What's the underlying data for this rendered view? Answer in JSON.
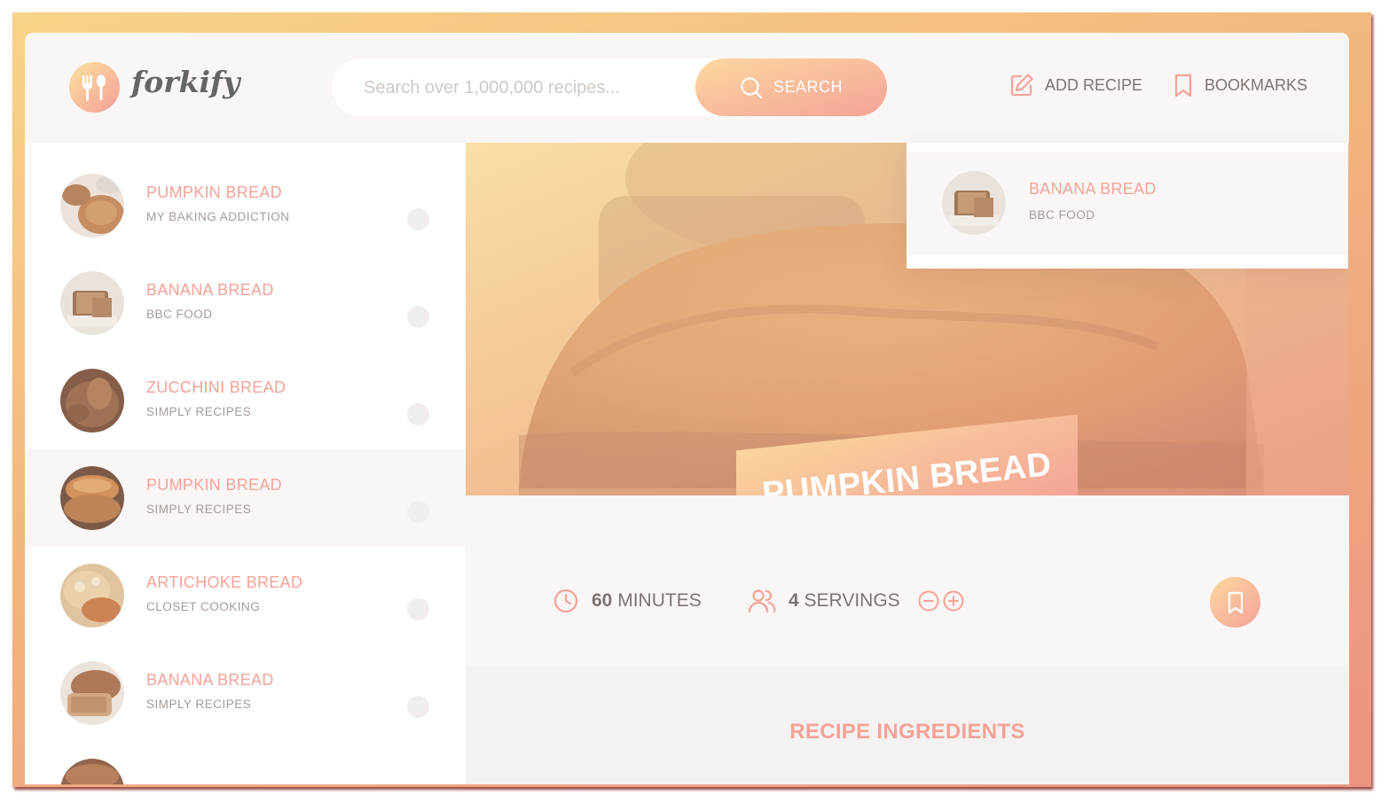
{
  "app": {
    "name": "forkify"
  },
  "search": {
    "placeholder": "Search over 1,000,000 recipes...",
    "button_label": "SEARCH"
  },
  "nav": {
    "add_recipe": "ADD RECIPE",
    "bookmarks": "BOOKMARKS"
  },
  "results": [
    {
      "title": "PUMPKIN BREAD",
      "publisher": "MY BAKING ADDICTION",
      "active": false
    },
    {
      "title": "BANANA BREAD",
      "publisher": "BBC FOOD",
      "active": false
    },
    {
      "title": "ZUCCHINI BREAD",
      "publisher": "SIMPLY RECIPES",
      "active": false
    },
    {
      "title": "PUMPKIN BREAD",
      "publisher": "SIMPLY RECIPES",
      "active": true
    },
    {
      "title": "ARTICHOKE BREAD",
      "publisher": "CLOSET COOKING",
      "active": false
    },
    {
      "title": "BANANA BREAD",
      "publisher": "SIMPLY RECIPES",
      "active": false
    }
  ],
  "bookmarks_preview": [
    {
      "title": "BANANA BREAD",
      "publisher": "BBC FOOD"
    }
  ],
  "recipe": {
    "title": "PUMPKIN BREAD",
    "cooking_time": "60",
    "cooking_time_unit": "MINUTES",
    "servings": "4",
    "servings_unit": "SERVINGS",
    "ingredients_heading": "RECIPE INGREDIENTS"
  },
  "colors": {
    "accent": "#f38e82",
    "accent_light": "#fbd08b",
    "text": "#615551",
    "muted": "#918581",
    "background": "#f9f5f3"
  },
  "icons": [
    "fork-spoon-icon",
    "search-icon",
    "edit-icon",
    "bookmark-icon",
    "clock-icon",
    "users-icon",
    "minus-circle-icon",
    "plus-circle-icon"
  ]
}
